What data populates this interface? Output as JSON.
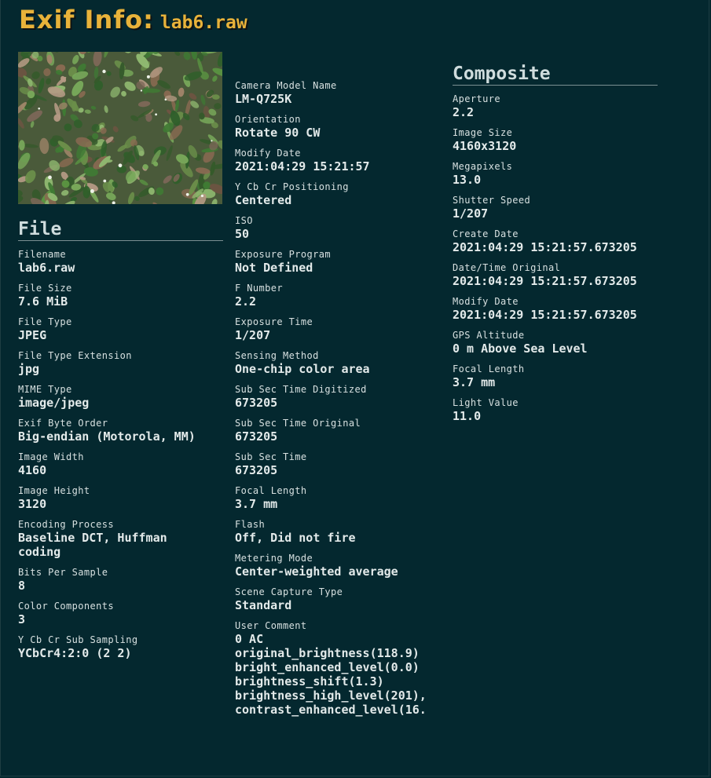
{
  "title": {
    "label": "Exif Info:",
    "filename": "lab6.raw"
  },
  "thumbnail": {
    "description_icon": "photo-thumbnail"
  },
  "file": {
    "heading": "File",
    "fields": [
      {
        "k": "Filename",
        "v": "lab6.raw"
      },
      {
        "k": "File Size",
        "v": "7.6 MiB"
      },
      {
        "k": "File Type",
        "v": "JPEG"
      },
      {
        "k": "File Type Extension",
        "v": "jpg"
      },
      {
        "k": "MIME Type",
        "v": "image/jpeg"
      },
      {
        "k": "Exif Byte Order",
        "v": "Big-endian (Motorola, MM)"
      },
      {
        "k": "Image Width",
        "v": "4160"
      },
      {
        "k": "Image Height",
        "v": "3120"
      },
      {
        "k": "Encoding Process",
        "v": "Baseline DCT, Huffman\ncoding"
      },
      {
        "k": "Bits Per Sample",
        "v": "8"
      },
      {
        "k": "Color Components",
        "v": "3"
      },
      {
        "k": "Y Cb Cr Sub Sampling",
        "v": "YCbCr4:2:0 (2 2)"
      }
    ]
  },
  "exif": {
    "fields": [
      {
        "k": "Camera Model Name",
        "v": "LM-Q725K"
      },
      {
        "k": "Orientation",
        "v": "Rotate 90 CW"
      },
      {
        "k": "Modify Date",
        "v": "2021:04:29 15:21:57"
      },
      {
        "k": "Y Cb Cr Positioning",
        "v": "Centered"
      },
      {
        "k": "ISO",
        "v": "50"
      },
      {
        "k": "Exposure Program",
        "v": "Not Defined"
      },
      {
        "k": "F Number",
        "v": "2.2"
      },
      {
        "k": "Exposure Time",
        "v": "1/207"
      },
      {
        "k": "Sensing Method",
        "v": "One-chip color area"
      },
      {
        "k": "Sub Sec Time Digitized",
        "v": "673205"
      },
      {
        "k": "Sub Sec Time Original",
        "v": "673205"
      },
      {
        "k": "Sub Sec Time",
        "v": "673205"
      },
      {
        "k": "Focal Length",
        "v": "3.7 mm"
      },
      {
        "k": "Flash",
        "v": "Off, Did not fire"
      },
      {
        "k": "Metering Mode",
        "v": "Center-weighted average"
      },
      {
        "k": "Scene Capture Type",
        "v": "Standard"
      },
      {
        "k": "User Comment",
        "v": "0 AC\noriginal_brightness(118.9)\nbright_enhanced_level(0.0)\nbrightness_shift(1.3)\nbrightness_high_level(201),\ncontrast_enhanced_level(16."
      }
    ]
  },
  "composite": {
    "heading": "Composite",
    "fields": [
      {
        "k": "Aperture",
        "v": "2.2"
      },
      {
        "k": "Image Size",
        "v": "4160x3120"
      },
      {
        "k": "Megapixels",
        "v": "13.0"
      },
      {
        "k": "Shutter Speed",
        "v": "1/207"
      },
      {
        "k": "Create Date",
        "v": "2021:04:29 15:21:57.673205"
      },
      {
        "k": "Date/Time Original",
        "v": "2021:04:29 15:21:57.673205"
      },
      {
        "k": "Modify Date",
        "v": "2021:04:29 15:21:57.673205"
      },
      {
        "k": "GPS Altitude",
        "v": "0 m Above Sea Level"
      },
      {
        "k": "Focal Length",
        "v": "3.7 mm"
      },
      {
        "k": "Light Value",
        "v": "11.0"
      }
    ]
  },
  "colors": {
    "background": "#04282f",
    "title": "#e8b23a",
    "text": "#e3eaea"
  }
}
